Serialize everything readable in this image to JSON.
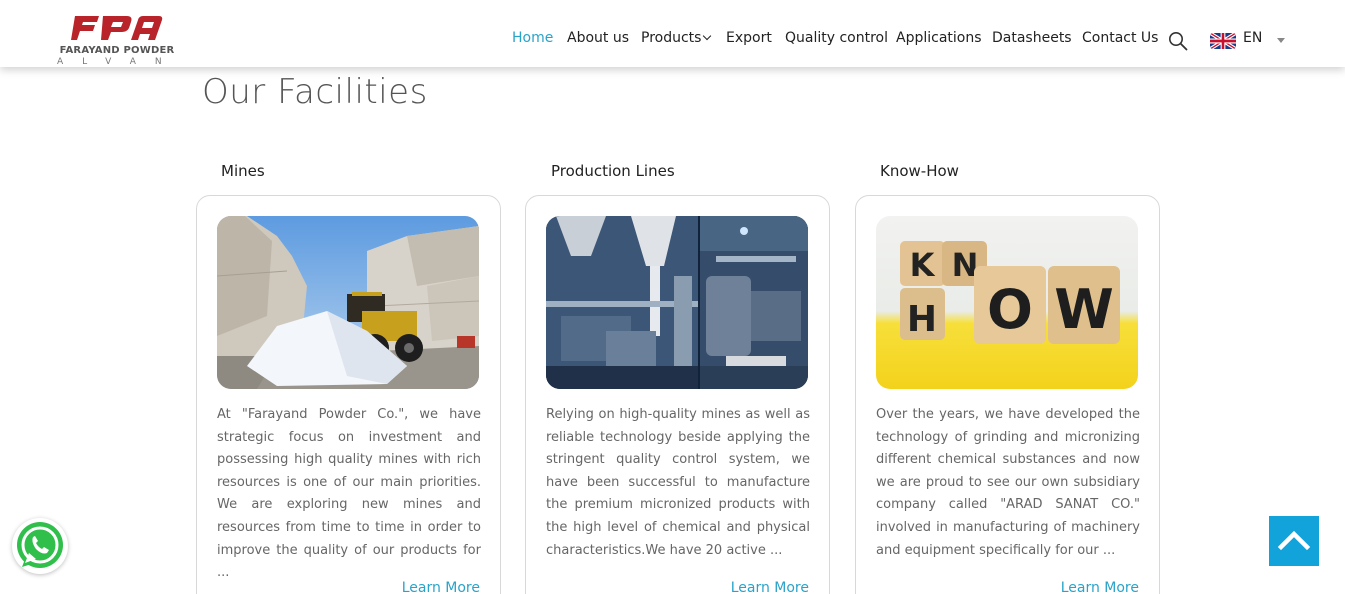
{
  "brand": {
    "logo_mark": "FPA",
    "name": "FARAYAND POWDER",
    "sub": "ALVAN",
    "red": "#b8242a"
  },
  "nav": {
    "items": [
      {
        "label": "Home",
        "active": true
      },
      {
        "label": "About us"
      },
      {
        "label": "Products",
        "has_dropdown": true
      },
      {
        "label": "Export"
      },
      {
        "label": "Quality control"
      },
      {
        "label": "Applications"
      },
      {
        "label": "Datasheets"
      },
      {
        "label": "Contact Us"
      }
    ],
    "search_icon": "search-icon",
    "language": {
      "code": "EN",
      "flag": "uk-flag-icon"
    }
  },
  "section": {
    "title": "Our Facilities"
  },
  "cards": [
    {
      "label": "Mines",
      "image": "marble-quarry-photo",
      "text": "At \"Farayand Powder Co.\", we have strategic focus on investment and possessing high quality mines with rich resources is one of our main priorities. We are exploring new mines and resources from time to time in order to improve the quality of our products for ...",
      "link": "Learn More"
    },
    {
      "label": "Production Lines",
      "image": "production-line-photo",
      "text": "Relying on high-quality mines as well as reliable technology beside applying the stringent quality control system, we have been successful to manufacture the premium micronized products with the high level of chemical and physical characteristics.We have 20 active ...",
      "link": "Learn More"
    },
    {
      "label": "Know-How",
      "image": "know-how-blocks-photo",
      "text": "Over the years, we have developed the technology of grinding and micronizing different chemical substances and now we are proud to see our own subsidiary company called \"ARAD SANAT CO.\" involved in manufacturing of machinery and equipment specifically for our ...",
      "link": "Learn More"
    }
  ],
  "know_how_blocks": {
    "top": [
      "K",
      "N"
    ],
    "bottom": [
      "H",
      "O",
      "W"
    ]
  },
  "floating": {
    "whatsapp_icon": "whatsapp-icon",
    "scroll_top_icon": "chevron-up-icon",
    "accent": "#12a3db"
  }
}
